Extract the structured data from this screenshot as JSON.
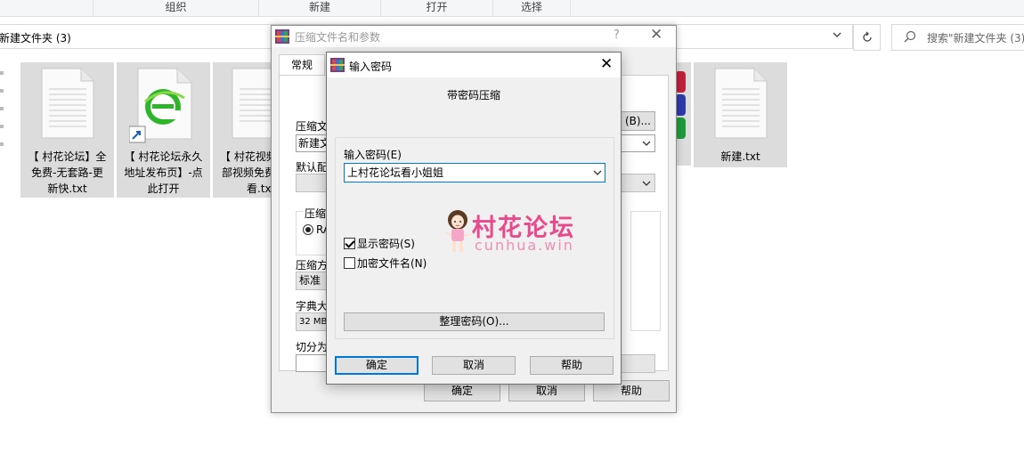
{
  "explorer": {
    "ribbon_groups": [
      "组织",
      "新建",
      "打开",
      "选择"
    ],
    "address": "新建文件夹 (3)",
    "search_placeholder": "搜索\"新建文件夹 (3)",
    "files": [
      {
        "name_line1": "【 村花论坛】全",
        "name_line2": "免费-无套路-更",
        "name_line3": "新快.txt",
        "type": "txt-icon"
      },
      {
        "name_line1": "【 村花论坛永久",
        "name_line2": "地址发布页】-点",
        "name_line3": "此打开",
        "type": "ie-shortcut-icon"
      },
      {
        "name_line1": "【 村花视频",
        "name_line2": "部视频免费",
        "name_line3": "看.txt",
        "type": "txt-icon"
      },
      {
        "name_line1": "新建.txt",
        "type": "txt-icon"
      }
    ]
  },
  "archive_dialog": {
    "title": "压缩文件名和参数",
    "help_glyph": "?",
    "close_glyph": "✕",
    "tab_general": "常规",
    "label_archive_name": "压缩文",
    "archive_name_value": "新建文",
    "browse_button": "(B)...",
    "label_default_profile": "默认配",
    "label_format": "压缩文",
    "format_option": "RA",
    "label_method": "压缩方",
    "method_value": "标准",
    "label_dictionary": "字典大",
    "dictionary_value": "32 MB",
    "label_split": "切分为",
    "ok_button": "确定",
    "cancel_button": "取消",
    "help_button": "帮助"
  },
  "password_dialog": {
    "title": "输入密码",
    "close_glyph": "✕",
    "subtitle": "带密码压缩",
    "password_label": "输入密码(E)",
    "password_value": "上村花论坛看小姐姐",
    "show_password_label": "显示密码(S)",
    "show_password_checked": true,
    "encrypt_names_label": "加密文件名(N)",
    "encrypt_names_checked": false,
    "organize_button": "整理密码(O)...",
    "ok_button": "确定",
    "cancel_button": "取消",
    "help_button": "帮助"
  },
  "watermark": {
    "title": "村花论坛",
    "subtitle": "cunhua.win"
  },
  "colors": {
    "accent": "#0078d7",
    "watermark_pink": "#e84a8c"
  }
}
